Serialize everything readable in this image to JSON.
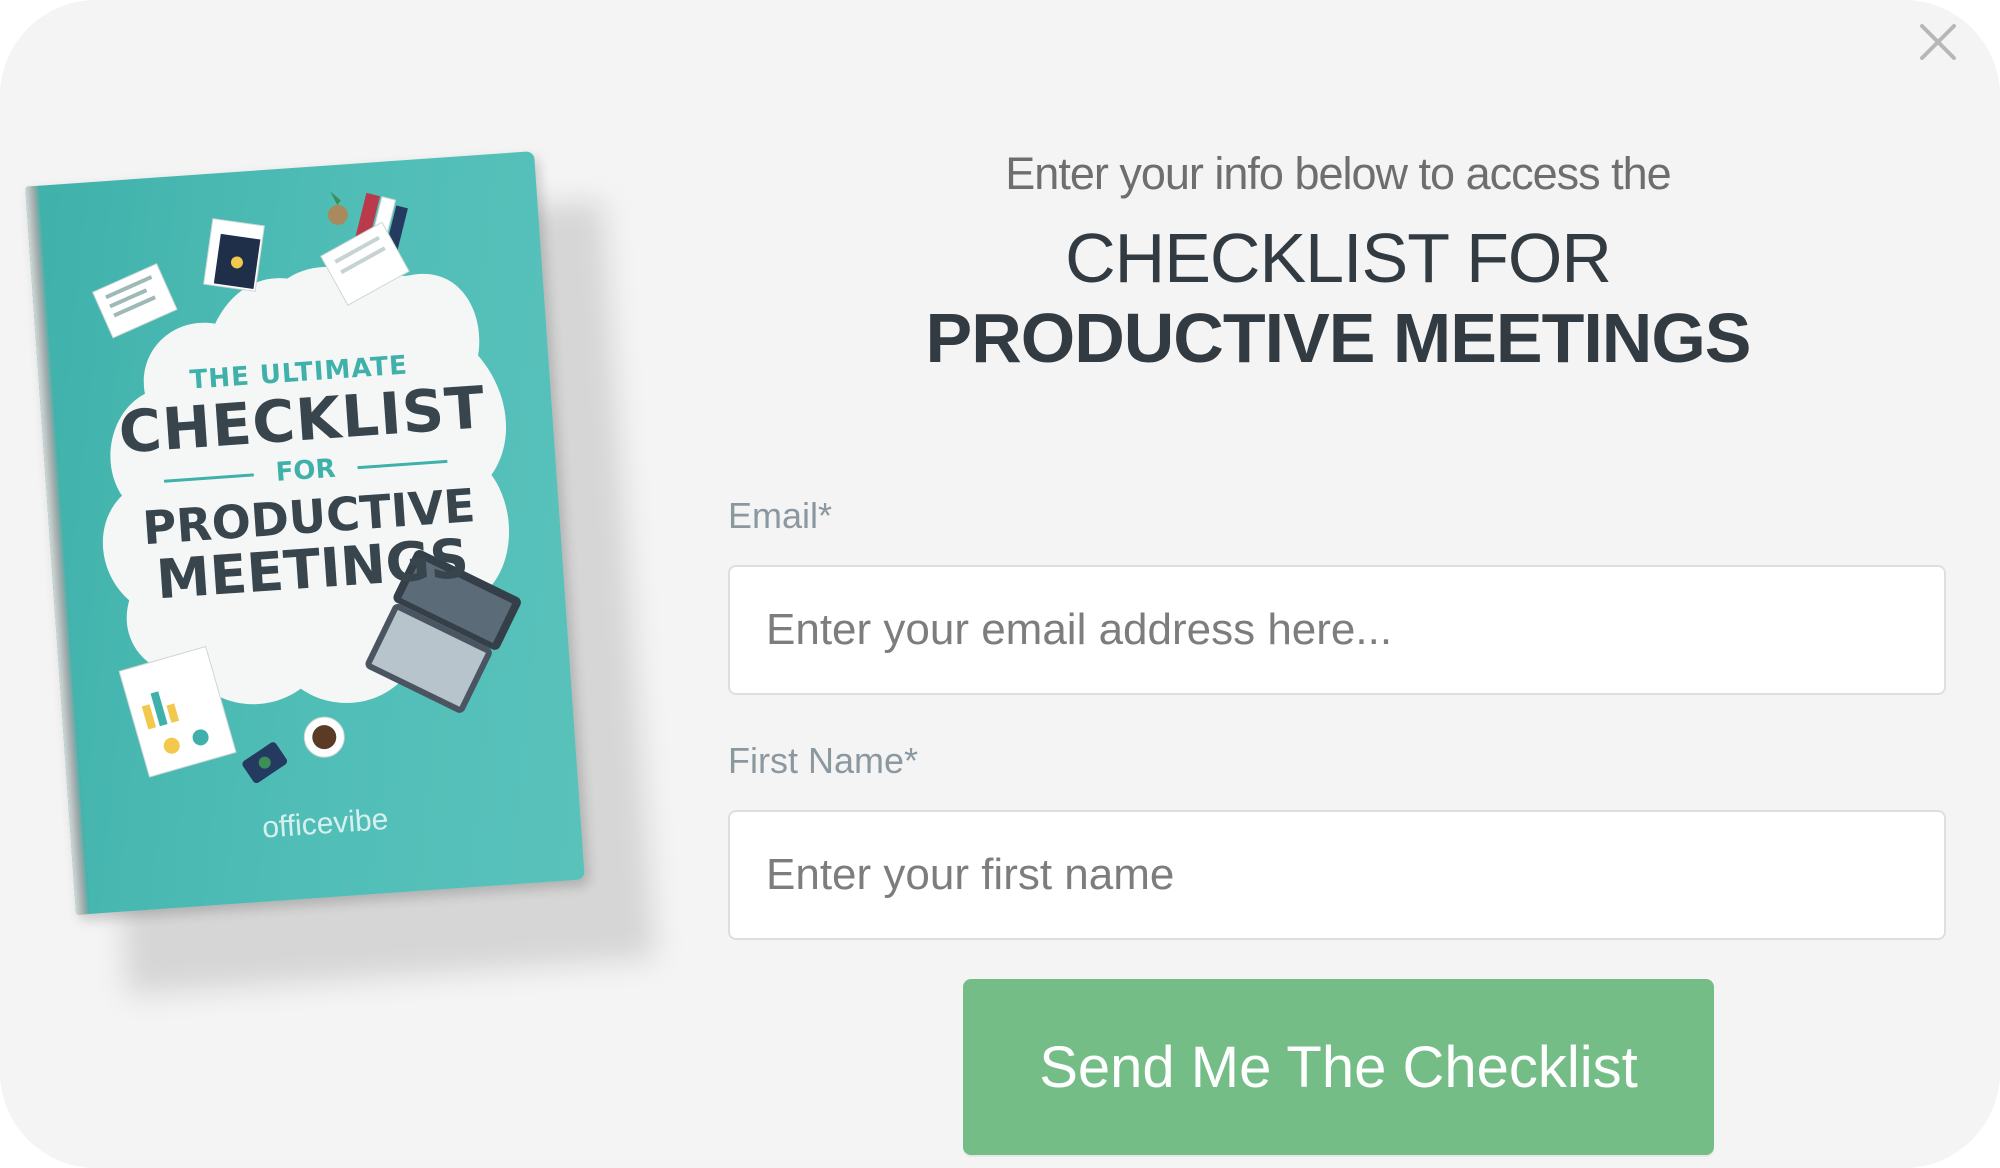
{
  "modal": {
    "close_icon": "close-icon",
    "colors": {
      "background": "#f4f4f4",
      "accent_green": "#74bd86",
      "teal": "#4fbdb6",
      "heading": "#333b42"
    }
  },
  "book": {
    "label_ultimate": "THE ULTIMATE",
    "label_checklist": "CHECKLIST",
    "label_for": "FOR",
    "label_productive": "PRODUCTIVE",
    "label_meetings": "MEETINGS",
    "brand": "officevibe"
  },
  "form": {
    "intro": "Enter your info below to access the",
    "title_line1": "CHECKLIST FOR",
    "title_line2": "PRODUCTIVE MEETINGS",
    "email_label": "Email*",
    "email_placeholder": "Enter your email address here...",
    "name_label": "First Name*",
    "name_placeholder": "Enter your first name",
    "submit_label": "Send Me The Checklist"
  }
}
